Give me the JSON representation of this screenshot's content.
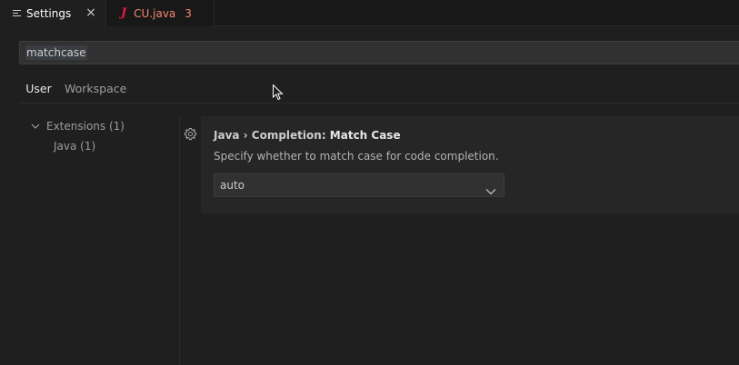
{
  "tabs": [
    {
      "label": "Settings",
      "icon": "settings-list-icon",
      "active": true
    },
    {
      "label": "CU.java",
      "icon": "java-icon",
      "badge": "3",
      "color": "#f48771"
    }
  ],
  "search": {
    "value": "matchcase"
  },
  "scope_tabs": [
    {
      "label": "User",
      "active": true
    },
    {
      "label": "Workspace"
    }
  ],
  "toc": {
    "extensions": "Extensions (1)",
    "java": "Java (1)"
  },
  "setting": {
    "category": "Java › Completion: ",
    "name": "Match Case",
    "description": "Specify whether to match case for code completion.",
    "value": "auto"
  },
  "colors": {
    "background": "#1f1f1f",
    "java_icon": "#e5183f",
    "error_tab": "#f48771"
  }
}
